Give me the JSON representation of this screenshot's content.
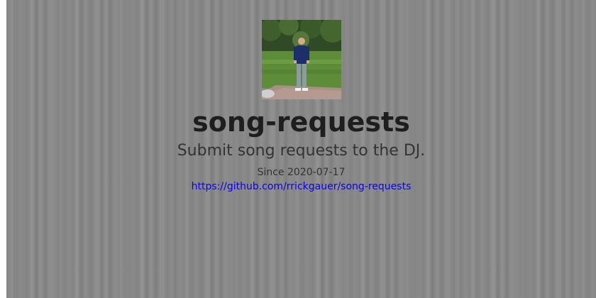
{
  "profile": {
    "avatar_alt": "profile photo"
  },
  "project": {
    "title": "song-requests",
    "tagline": "Submit song requests to the DJ.",
    "since": "Since 2020-07-17",
    "repo_url": "https://github.com/rrickgauer/song-requests"
  },
  "colors": {
    "background": "#8a8a8a",
    "title": "#1e1e1e",
    "text": "#333333",
    "link": "#0b00ee"
  }
}
